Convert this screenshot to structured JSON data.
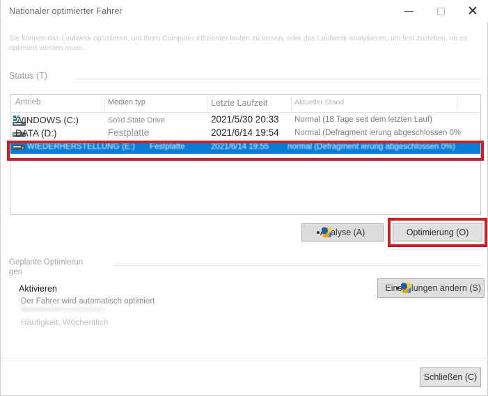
{
  "window": {
    "title": "Nationaler optimierter Fahrer",
    "controls": {
      "minimize": "minimize-icon",
      "maximize": "maximize-icon",
      "close": "✕"
    }
  },
  "intro": {
    "description": "Sie können das Laufwerk optimieren, um Ihren Computer effizienter laufen zu lassen, oder das Laufwerk analysieren, um fest zustellen, ob es optimiert werden muss."
  },
  "status_section": {
    "label": "Status (T)",
    "table": {
      "columns": [
        "Antrieb",
        "Medien typ",
        "Letzte Laufzeit",
        "Aktueller Stand"
      ],
      "rows": [
        {
          "icon": "ssd-drive-icon",
          "drive": "WINDOWS (C:)",
          "media_type": "Solid State Drive",
          "last_run": "2021/5/30 20:33",
          "status": "Normal (18 Tage seit dem letzten Lauf)",
          "selected": false
        },
        {
          "icon": "hdd-drive-icon",
          "drive": "DATA (D:)",
          "media_type": "Festplatte",
          "last_run": "2021/6/14 19:54",
          "status": "Normal (Defragment ierung abgeschlossen 0%",
          "selected": false
        },
        {
          "icon": "hdd-drive-icon",
          "drive": "WIEDERHERSTELLUNG (E:)",
          "media_type": "Festplatte",
          "last_run": "2021/6/14 19:55",
          "status": "normal (Defragment ierung abgeschlossen 0%)",
          "selected": true
        }
      ]
    },
    "buttons": {
      "analyse": "Analyse (A)",
      "optimize": "Optimierung (O)"
    }
  },
  "scheduled_section": {
    "label": "Geplante Optimierun gen",
    "activated": "Aktivieren",
    "auto_description": "Der Fahrer wird automatisch optimiert",
    "frequency": "Häufigkeit: Wöchentlich",
    "change_settings_button": "Einstellungen ändern (S)"
  },
  "footer": {
    "close_button": "Schließen (C)"
  },
  "annotations": {
    "highlight_color": "#cc1f24",
    "selection_color": "#0a7cd4"
  }
}
